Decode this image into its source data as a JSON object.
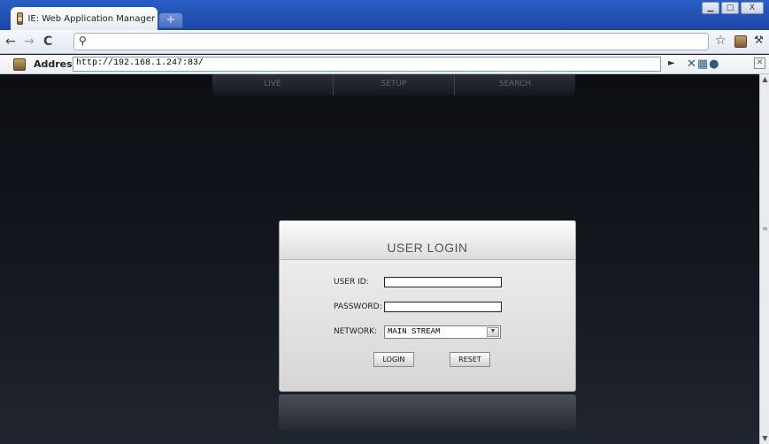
{
  "browser": {
    "tab_title": "IE: Web Application Manager",
    "tab_close": "×",
    "new_tab": "+",
    "window_buttons": {
      "minimize": "▁",
      "maximize": "□",
      "close": "X"
    }
  },
  "toolbar": {
    "back": "←",
    "forward": "→",
    "reload": "C",
    "search": "🔍",
    "star": "☆",
    "page_menu": "⬚",
    "wrench": "🔧"
  },
  "ie_addressbar": {
    "label": "Address:",
    "url": "http://192.168.1.247:83/",
    "go": "►",
    "tools": "✕▦●",
    "close": "✕"
  },
  "top_nav": {
    "items": [
      "LIVE",
      "SETUP",
      "SEARCH"
    ]
  },
  "login": {
    "title": "USER LOGIN",
    "user_id_label": "USER ID:",
    "user_id_value": "",
    "password_label": "PASSWORD:",
    "password_value": "",
    "network_label": "NETWORK:",
    "network_selected": "MAIN STREAM",
    "login_button": "LOGIN",
    "reset_button": "RESET"
  },
  "scrollbar": {
    "up": "▲",
    "down": "▼",
    "grip": "≡"
  }
}
